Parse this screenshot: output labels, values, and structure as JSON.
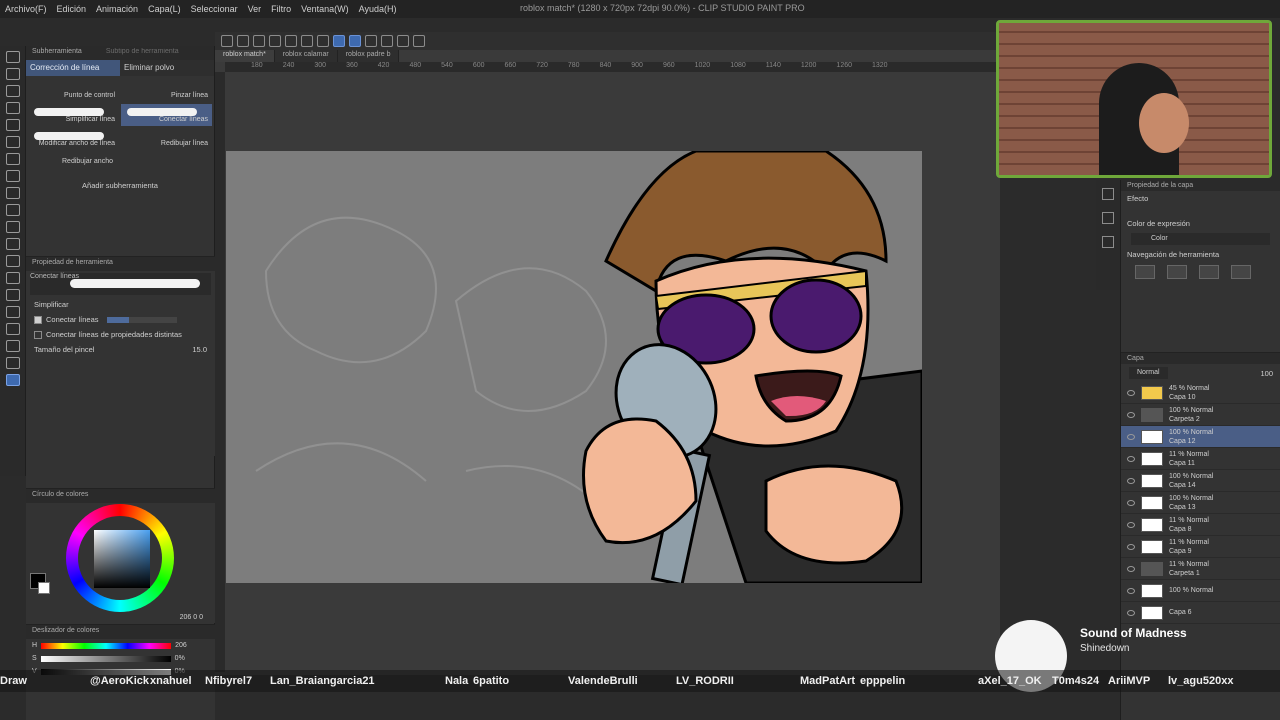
{
  "menu": [
    "Archivo(F)",
    "Edición",
    "Animación",
    "Capa(L)",
    "Seleccionar",
    "Ver",
    "Filtro",
    "Ventana(W)",
    "Ayuda(H)"
  ],
  "window_title": "roblox match* (1280 x 720px 72dpi 90.0%) - CLIP STUDIO PAINT PRO",
  "left": {
    "header_tabs": [
      "Subherramienta",
      "Subtipo de herramienta"
    ],
    "subtabs": [
      "Corrección de línea",
      "Eliminar polvo"
    ],
    "brushes": [
      {
        "label": "Punto de control",
        "selected": false
      },
      {
        "label": "Pinzar línea",
        "selected": false
      },
      {
        "label": "Simplificar línea",
        "selected": false
      },
      {
        "label": "Conectar líneas",
        "selected": true
      },
      {
        "label": "Modificar ancho de línea",
        "selected": false
      },
      {
        "label": "Redibujar línea",
        "selected": false
      }
    ],
    "single": "Redibujar ancho",
    "add_sub": "Añadir subherramienta",
    "prop_header": "Propiedad de herramienta",
    "prop_stroke_label": "Conectar líneas",
    "simplify": "Simplificar",
    "connect": "Conectar líneas",
    "connect_diff": "Conectar líneas de propiedades distintas",
    "brush_size_label": "Tamaño del pincel",
    "brush_size_value": "15.0",
    "color_circle": "Círculo de colores",
    "color_values": "206  0  0",
    "color_slider": "Deslizador de colores",
    "slider_h": "206",
    "slider_s": "0%",
    "slider_v": "0%"
  },
  "doc_tabs": [
    "roblox match*",
    "roblox calamar",
    "roblox padre b"
  ],
  "ruler_ticks": [
    "180",
    "240",
    "300",
    "360",
    "420",
    "480",
    "540",
    "600",
    "660",
    "720",
    "780",
    "840",
    "900",
    "960",
    "1020",
    "1080",
    "1140",
    "1200",
    "1260",
    "1320"
  ],
  "right": {
    "prop_layer_header": "Propiedad de la capa",
    "effect": "Efecto",
    "expr_color": "Color de expresión",
    "expr_value": "Color",
    "nav_tool": "Navegación de herramienta",
    "layer_header": "Capa",
    "blend": "Normal",
    "opacity": "100",
    "layers": [
      {
        "mode": "45 % Normal",
        "name": "Capa 10",
        "thumb": "yellow",
        "selected": false
      },
      {
        "mode": "100 % Normal",
        "name": "Carpeta 2",
        "thumb": "folder",
        "selected": false
      },
      {
        "mode": "100 % Normal",
        "name": "Capa 12",
        "thumb": "white",
        "selected": true
      },
      {
        "mode": "11 % Normal",
        "name": "Capa 11",
        "thumb": "white",
        "selected": false
      },
      {
        "mode": "100 % Normal",
        "name": "Capa 14",
        "thumb": "white",
        "selected": false
      },
      {
        "mode": "100 % Normal",
        "name": "Capa 13",
        "thumb": "white",
        "selected": false
      },
      {
        "mode": "11 % Normal",
        "name": "Capa 8",
        "thumb": "white",
        "selected": false
      },
      {
        "mode": "11 % Normal",
        "name": "Capa 9",
        "thumb": "white",
        "selected": false
      },
      {
        "mode": "11 % Normal",
        "name": "Carpeta 1",
        "thumb": "folder",
        "selected": false
      },
      {
        "mode": "100 % Normal",
        "name": "",
        "thumb": "white",
        "selected": false
      }
    ],
    "bottom_layer": "Capa 6"
  },
  "now_playing": {
    "title": "Sound of Madness",
    "artist": "Shinedown"
  },
  "chat_names": [
    "Draw",
    "@AeroKick",
    "xnahuel",
    "Nfibyrel7",
    "Lan_Braiangarcia21",
    "Nala",
    "6patito",
    "ValendeBrulli",
    "LV_RODRII",
    "MadPatArt",
    "epppelin",
    "aXel_17_OK",
    "T0m4s24",
    "AriiMVP",
    "lv_agu520xx"
  ],
  "colors": {
    "accent": "#4a5e86",
    "webcam_border": "#6fa83a",
    "canvas_bg": "#7d7d7d"
  }
}
